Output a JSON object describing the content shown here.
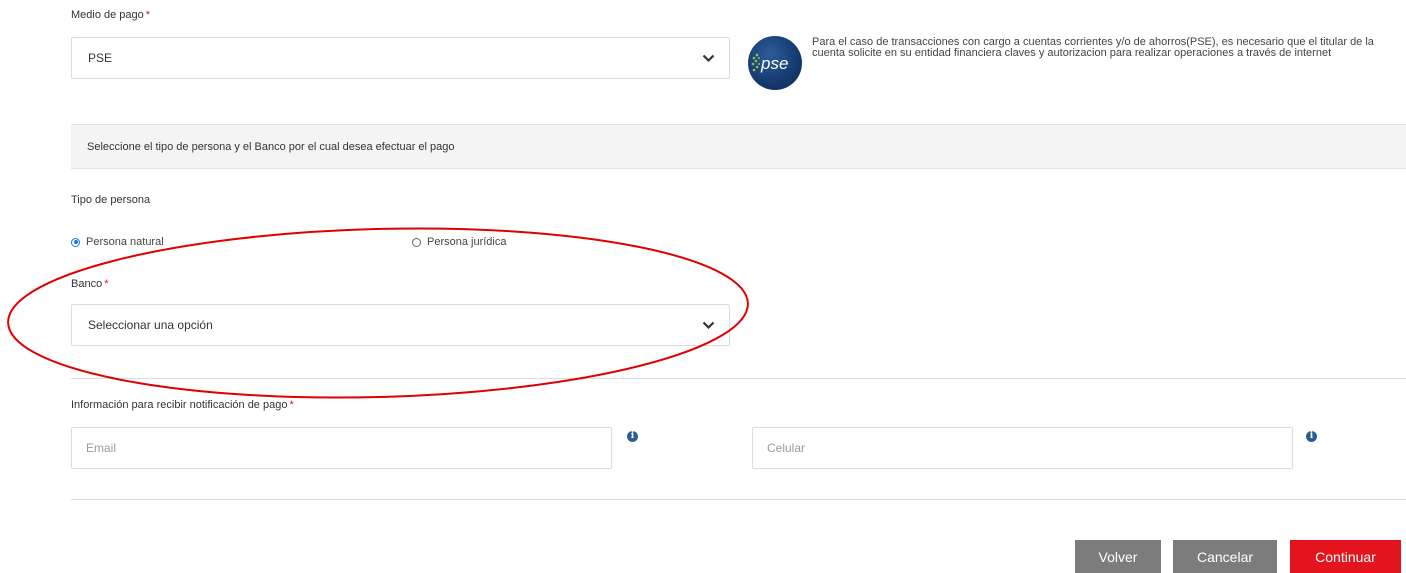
{
  "payment_method": {
    "label": "Medio de pago",
    "required_mark": "*",
    "selected": "PSE"
  },
  "pse_info": {
    "logo_text": "pse",
    "description": "Para el caso de transacciones con cargo a cuentas corrientes y/o de ahorros(PSE), es necesario que el titular de la cuenta solicite en su entidad financiera claves y autorizacion para realizar operaciones a través de internet"
  },
  "banner_text": "Seleccione el tipo de persona y el Banco por el cual desea efectuar el pago",
  "person_type": {
    "label": "Tipo de persona",
    "options": [
      {
        "label": "Persona natural",
        "selected": true
      },
      {
        "label": "Persona jurídica",
        "selected": false
      }
    ]
  },
  "bank": {
    "label": "Banco",
    "required_mark": "*",
    "selected": "Seleccionar una opción"
  },
  "notification": {
    "label": "Información para recibir notificación de pago",
    "required_mark": "*",
    "email_placeholder": "Email",
    "phone_placeholder": "Celular"
  },
  "buttons": {
    "back": "Volver",
    "cancel": "Cancelar",
    "continue": "Continuar"
  },
  "colors": {
    "accent_red": "#e4141e",
    "button_gray": "#7c7c7c",
    "radio_blue": "#1a73e8",
    "annotation_red": "#e00000"
  }
}
